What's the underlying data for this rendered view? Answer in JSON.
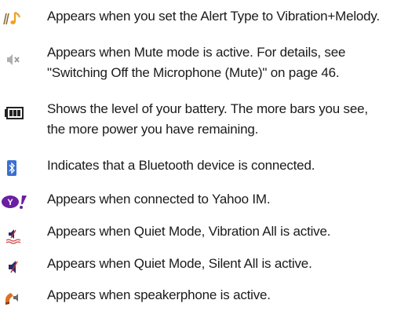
{
  "entries": [
    {
      "icon": "vibration-melody-icon",
      "lines": [
        "Appears when you set the Alert Type to Vibration+Melody."
      ]
    },
    {
      "icon": "mute-icon",
      "lines": [
        "Appears when Mute mode is active. For details, see",
        "\"Switching Off the Microphone (Mute)\" on page 46."
      ]
    },
    {
      "icon": "battery-icon",
      "lines": [
        "Shows the level of your battery. The more bars you see,",
        "the more power you have remaining."
      ]
    },
    {
      "icon": "bluetooth-icon",
      "lines": [
        "Indicates that a Bluetooth device is connected."
      ]
    },
    {
      "icon": "yahoo-im-icon",
      "lines": [
        "Appears when connected to Yahoo IM."
      ]
    },
    {
      "icon": "quiet-vibration-all-icon",
      "lines": [
        "Appears when Quiet Mode, Vibration All is active."
      ]
    },
    {
      "icon": "quiet-silent-all-icon",
      "lines": [
        "Appears when Quiet Mode, Silent All is active."
      ]
    },
    {
      "icon": "speakerphone-icon",
      "lines": [
        "Appears when speakerphone is active."
      ]
    }
  ],
  "colors": {
    "text": "#1a1a1a",
    "melody_orange": "#f0a020",
    "bluetooth_blue": "#3a6fd0",
    "yahoo_purple": "#6a1fa0",
    "speaker_orange": "#e07020"
  }
}
